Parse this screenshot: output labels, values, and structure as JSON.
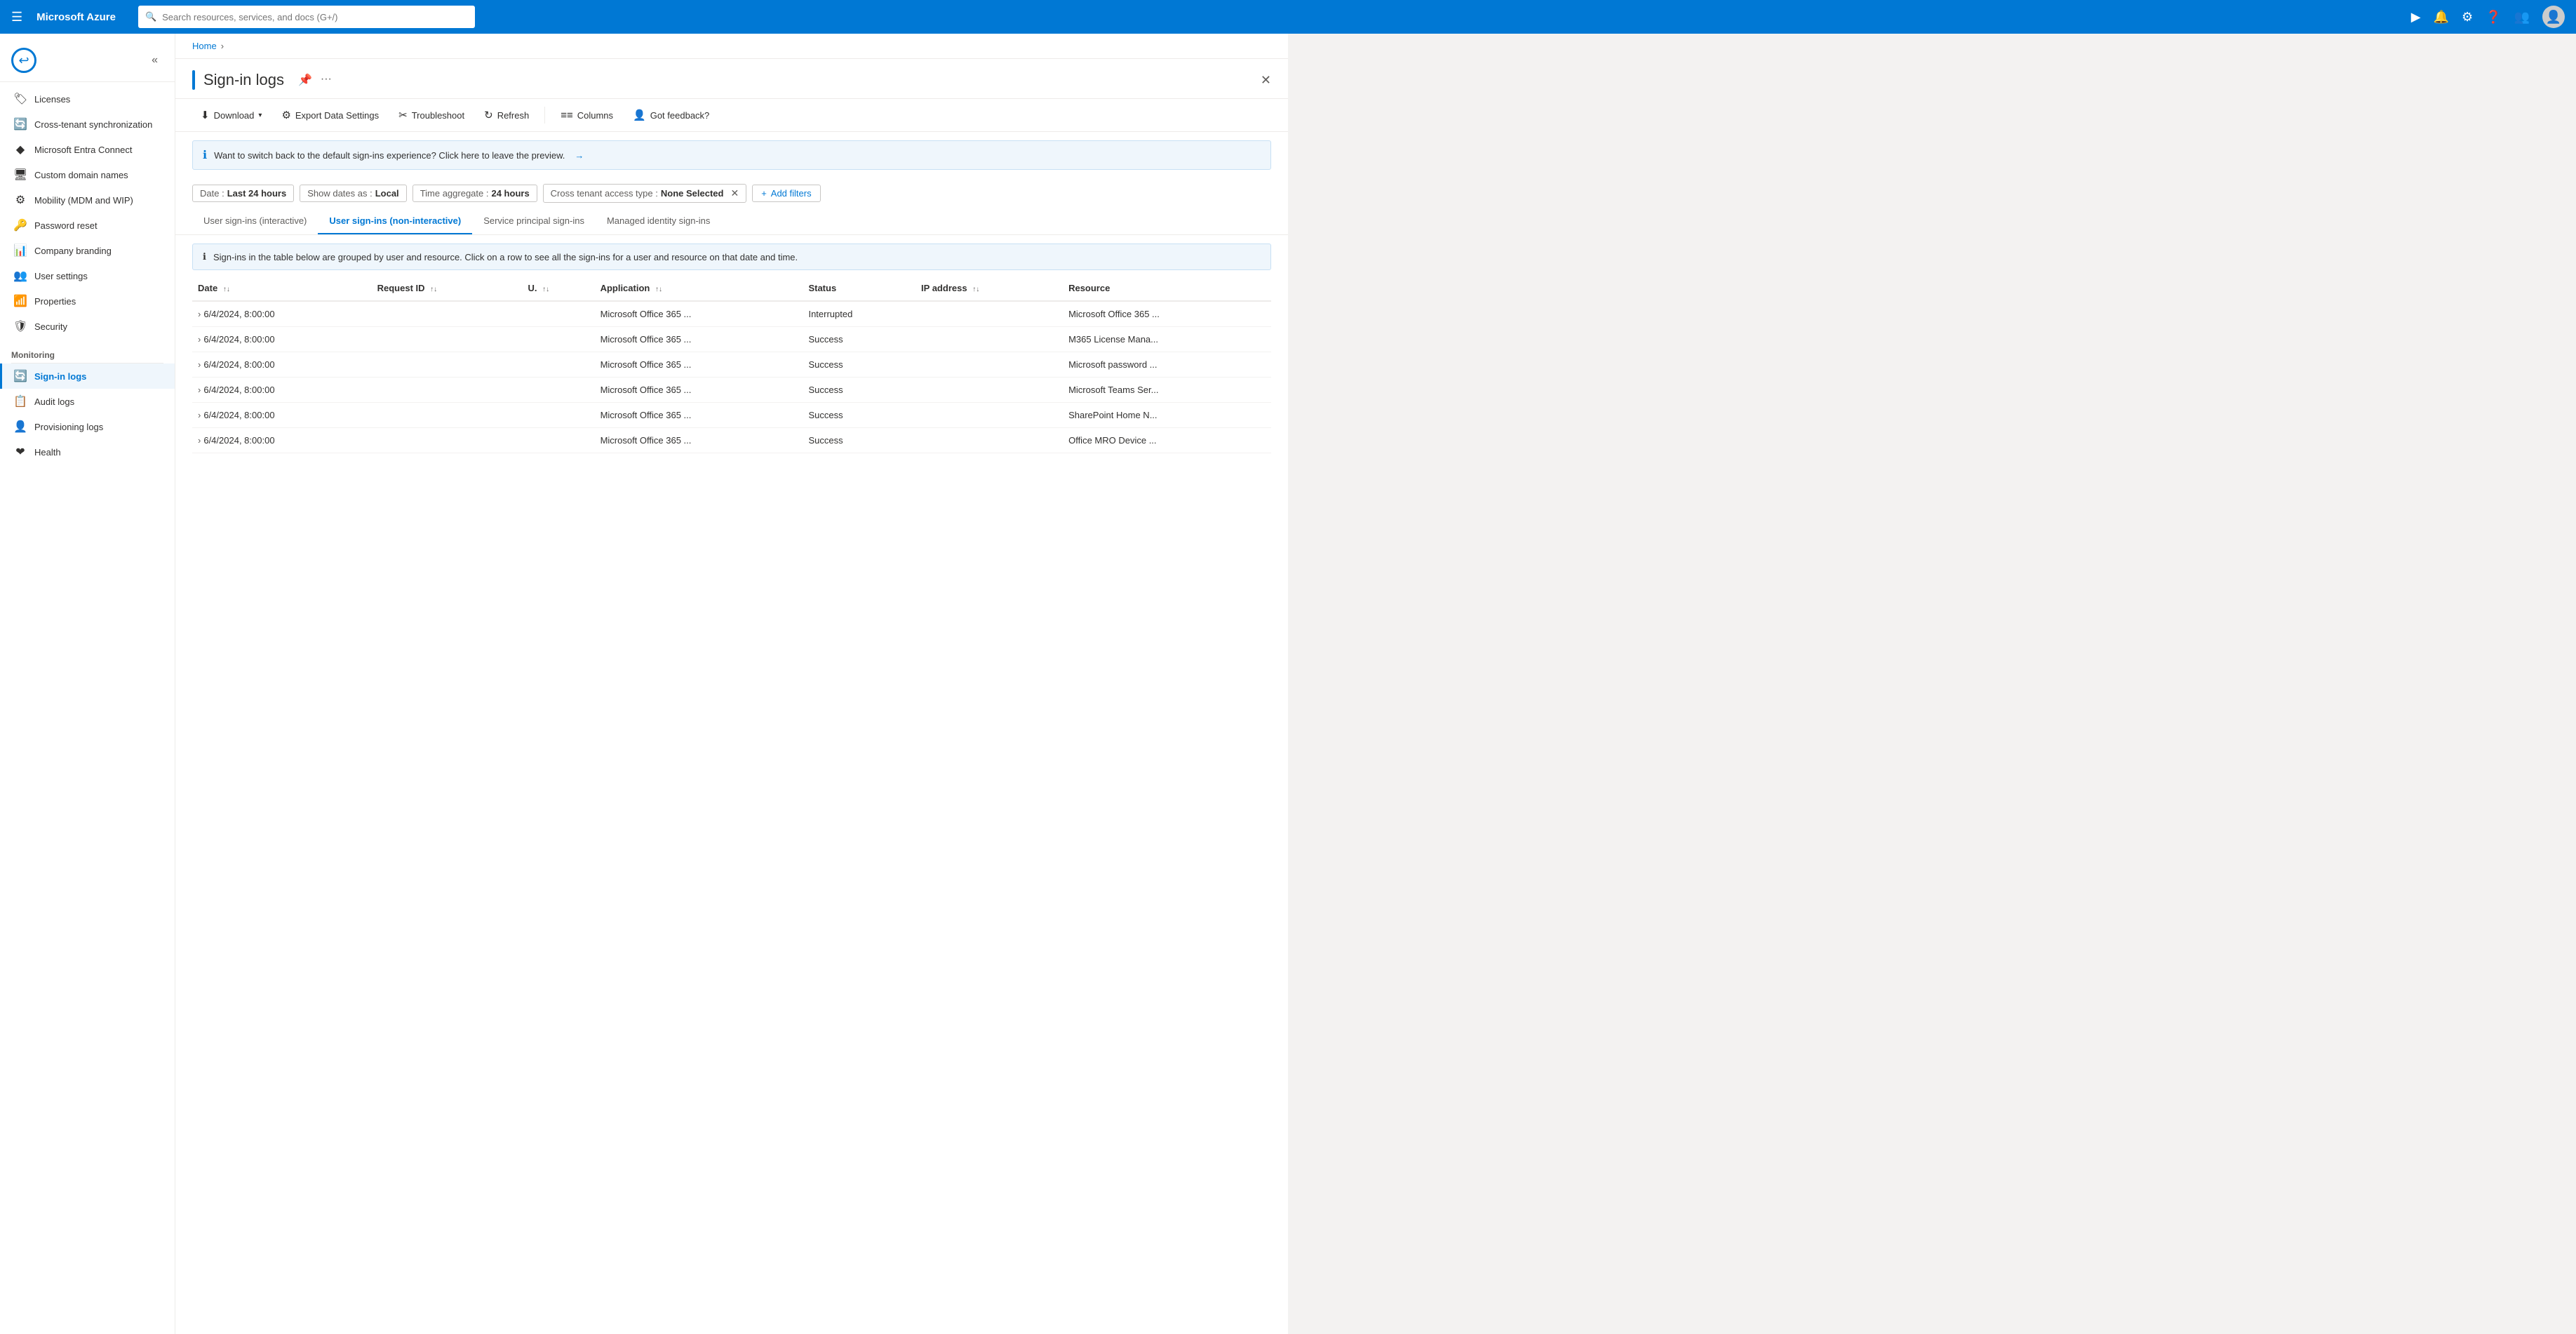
{
  "topbar": {
    "hamburger_label": "☰",
    "title": "Microsoft Azure",
    "search_placeholder": "Search resources, services, and docs (G+/)",
    "icons": [
      "▶",
      "🔔",
      "⚙",
      "?",
      "👥"
    ],
    "avatar_label": "👤"
  },
  "breadcrumb": {
    "home": "Home",
    "separator": "›"
  },
  "page": {
    "title": "Sign-in logs",
    "pin_icon": "📌",
    "more_icon": "···",
    "close_icon": "✕"
  },
  "toolbar": {
    "download_label": "Download",
    "download_icon": "⬇",
    "export_label": "Export Data Settings",
    "export_icon": "⚙",
    "troubleshoot_label": "Troubleshoot",
    "troubleshoot_icon": "✂",
    "refresh_label": "Refresh",
    "refresh_icon": "↻",
    "columns_label": "Columns",
    "columns_icon": "≡",
    "feedback_label": "Got feedback?",
    "feedback_icon": "👤"
  },
  "info_banner": {
    "icon": "ℹ",
    "text": "Want to switch back to the default sign-ins experience? Click here to leave the preview.",
    "arrow": "→"
  },
  "filters": {
    "date_label": "Date :",
    "date_value": "Last 24 hours",
    "dates_as_label": "Show dates as :",
    "dates_as_value": "Local",
    "time_agg_label": "Time aggregate :",
    "time_agg_value": "24 hours",
    "cross_tenant_label": "Cross tenant access type :",
    "cross_tenant_value": "None Selected",
    "add_filter_label": "+ Add filters"
  },
  "tabs": [
    {
      "id": "interactive",
      "label": "User sign-ins (interactive)",
      "active": false
    },
    {
      "id": "non-interactive",
      "label": "User sign-ins (non-interactive)",
      "active": true
    },
    {
      "id": "service-principal",
      "label": "Service principal sign-ins",
      "active": false
    },
    {
      "id": "managed-identity",
      "label": "Managed identity sign-ins",
      "active": false
    }
  ],
  "table_info_banner": {
    "icon": "ℹ",
    "text": "Sign-ins in the table below are grouped by user and resource. Click on a row to see all the sign-ins for a user and resource on that date and time."
  },
  "table": {
    "columns": [
      {
        "id": "date",
        "label": "Date",
        "sortable": true
      },
      {
        "id": "request_id",
        "label": "Request ID",
        "sortable": true
      },
      {
        "id": "u",
        "label": "U.",
        "sortable": true
      },
      {
        "id": "application",
        "label": "Application",
        "sortable": true
      },
      {
        "id": "status",
        "label": "Status",
        "sortable": false
      },
      {
        "id": "ip_address",
        "label": "IP address",
        "sortable": true
      },
      {
        "id": "resource",
        "label": "Resource",
        "sortable": false
      }
    ],
    "rows": [
      {
        "date": "6/4/2024, 8:00:00",
        "request_id": "",
        "u": "",
        "application": "Microsoft Office 365 ...",
        "status": "Interrupted",
        "ip_address": "",
        "resource": "Microsoft Office 365 ..."
      },
      {
        "date": "6/4/2024, 8:00:00",
        "request_id": "",
        "u": "",
        "application": "Microsoft Office 365 ...",
        "status": "Success",
        "ip_address": "",
        "resource": "M365 License Mana..."
      },
      {
        "date": "6/4/2024, 8:00:00",
        "request_id": "",
        "u": "",
        "application": "Microsoft Office 365 ...",
        "status": "Success",
        "ip_address": "",
        "resource": "Microsoft password ..."
      },
      {
        "date": "6/4/2024, 8:00:00",
        "request_id": "",
        "u": "",
        "application": "Microsoft Office 365 ...",
        "status": "Success",
        "ip_address": "",
        "resource": "Microsoft Teams Ser..."
      },
      {
        "date": "6/4/2024, 8:00:00",
        "request_id": "",
        "u": "",
        "application": "Microsoft Office 365 ...",
        "status": "Success",
        "ip_address": "",
        "resource": "SharePoint Home N..."
      },
      {
        "date": "6/4/2024, 8:00:00",
        "request_id": "",
        "u": "",
        "application": "Microsoft Office 365 ...",
        "status": "Success",
        "ip_address": "",
        "resource": "Office MRO Device ..."
      }
    ]
  },
  "sidebar": {
    "logo_icon": "↩",
    "items_top": [
      {
        "id": "licenses",
        "icon": "🏷",
        "label": "Licenses"
      },
      {
        "id": "cross-tenant-sync",
        "icon": "🔄",
        "label": "Cross-tenant synchronization"
      },
      {
        "id": "entra-connect",
        "icon": "◆",
        "label": "Microsoft Entra Connect"
      },
      {
        "id": "custom-domain",
        "icon": "🖥",
        "label": "Custom domain names"
      },
      {
        "id": "mobility",
        "icon": "🔘",
        "label": "Mobility (MDM and WIP)"
      },
      {
        "id": "password-reset",
        "icon": "🔑",
        "label": "Password reset"
      },
      {
        "id": "company-branding",
        "icon": "📊",
        "label": "Company branding"
      },
      {
        "id": "user-settings",
        "icon": "👥",
        "label": "User settings"
      },
      {
        "id": "properties",
        "icon": "📶",
        "label": "Properties"
      },
      {
        "id": "security",
        "icon": "🛡",
        "label": "Security"
      }
    ],
    "monitoring_label": "Monitoring",
    "items_monitoring": [
      {
        "id": "sign-in-logs",
        "icon": "🔄",
        "label": "Sign-in logs",
        "active": true
      },
      {
        "id": "audit-logs",
        "icon": "📋",
        "label": "Audit logs"
      },
      {
        "id": "provisioning-logs",
        "icon": "👤",
        "label": "Provisioning logs"
      },
      {
        "id": "health",
        "icon": "❤",
        "label": "Health"
      }
    ]
  }
}
